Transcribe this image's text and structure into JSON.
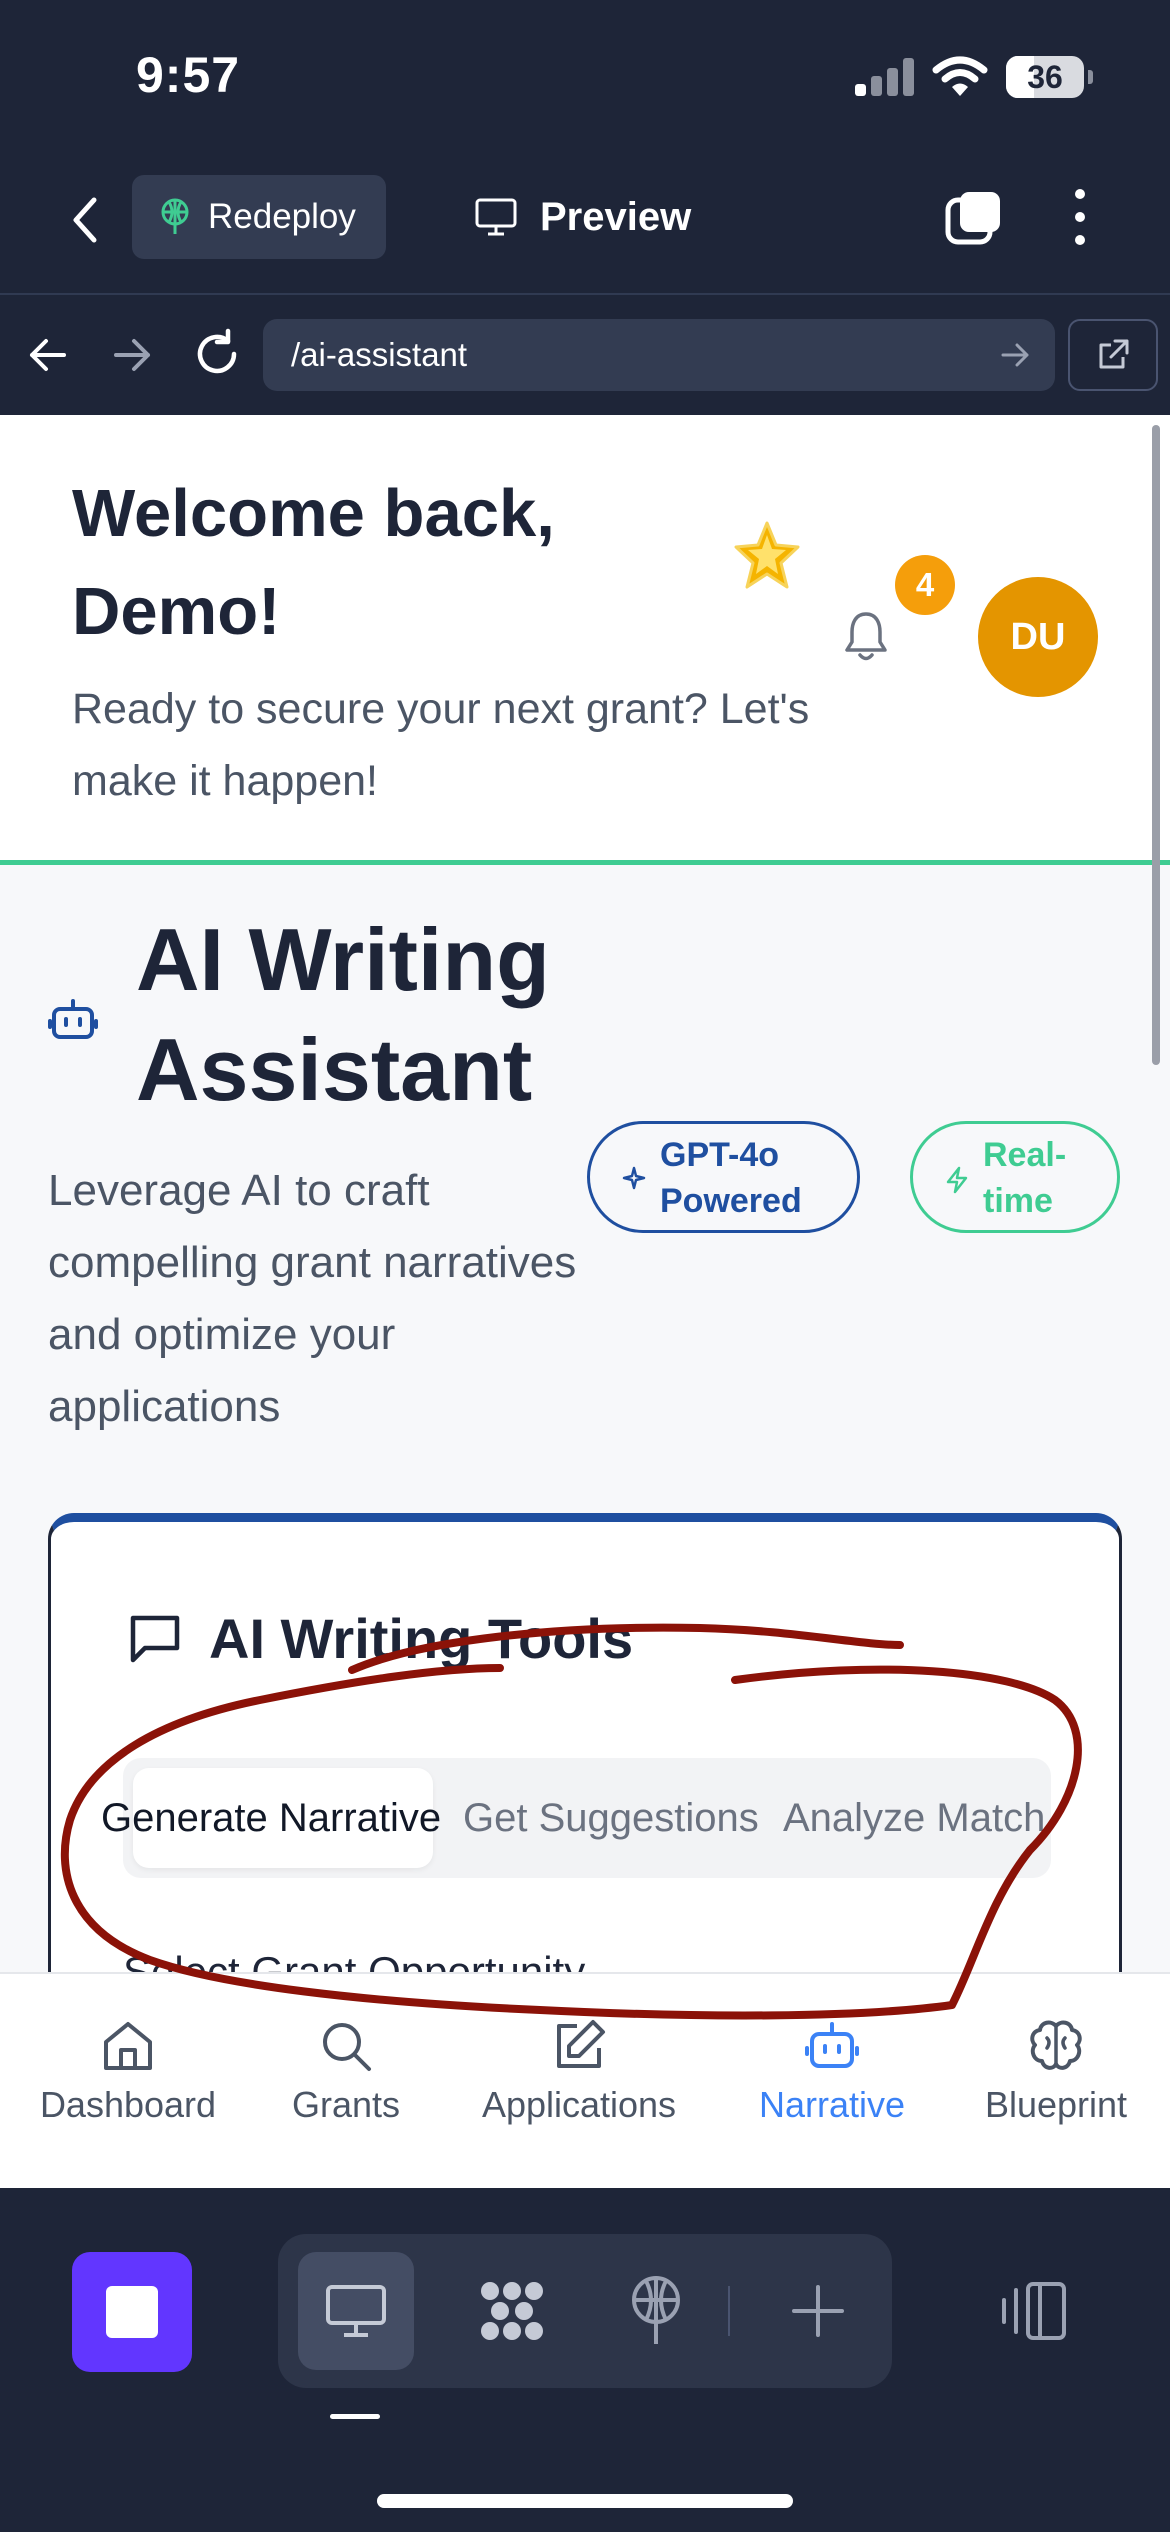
{
  "status_bar": {
    "time": "9:57",
    "battery": "36",
    "battery_level": 0.36
  },
  "toolbar": {
    "redeploy_label": "Redeploy",
    "preview_label": "Preview"
  },
  "urlbar": {
    "url": "/ai-assistant"
  },
  "header": {
    "welcome_title": "Welcome back, Demo!",
    "emoji": "🌟",
    "welcome_sub": "Ready to secure your next grant? Let's make it happen!",
    "notification_count": "4",
    "avatar_initials": "DU"
  },
  "main": {
    "title": "AI Writing Assistant",
    "description": "Leverage AI to craft compelling grant narratives and optimize your applications",
    "badges": [
      "GPT-4o Powered",
      "Real-time"
    ],
    "tools_card": {
      "title": "AI Writing Tools",
      "tabs": [
        "Generate Narrative",
        "Get Suggestions",
        "Analyze Match"
      ],
      "active_tab": "Generate Narrative",
      "select_label": "Select Grant Opportunity"
    }
  },
  "bottom_nav": {
    "items": [
      "Dashboard",
      "Grants",
      "Applications",
      "Narrative",
      "Blueprint"
    ],
    "active": "Narrative"
  },
  "colors": {
    "chrome_bg": "#1e2538",
    "accent_green": "#3fcc92",
    "accent_blue": "#1f4fa0",
    "active_nav": "#3b82f6",
    "badge_orange": "#f59e0b",
    "avatar_bg": "#e49500",
    "stop_purple": "#6236ff",
    "annotation_red": "#8b1208"
  },
  "icons": [
    "back-chevron-icon",
    "redeploy-icon",
    "monitor-icon",
    "tabs-icon",
    "more-vertical-icon",
    "arrow-left-icon",
    "arrow-right-icon",
    "reload-icon",
    "external-link-icon",
    "bell-icon",
    "robot-icon",
    "sparkles-icon",
    "lightning-icon",
    "chat-bubble-icon",
    "home-icon",
    "search-icon",
    "edit-icon",
    "brain-icon",
    "apps-icon",
    "plus-icon",
    "panel-icon"
  ]
}
